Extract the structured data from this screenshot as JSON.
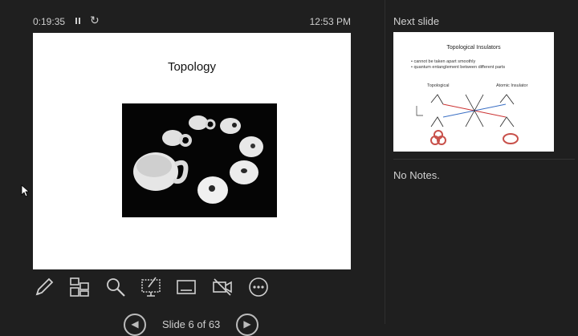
{
  "presenter": {
    "timer": "0:19:35",
    "clock": "12:53 PM",
    "pause_icon": "pause-icon",
    "restart_icon": "restart-icon"
  },
  "slide": {
    "title": "Topology",
    "image_desc_icon": "topology-photo"
  },
  "toolbar": {
    "tools": [
      "pen-icon",
      "slides-grid-icon",
      "zoom-icon",
      "pointer-screen-icon",
      "subtitles-icon",
      "camera-off-icon",
      "more-icon"
    ]
  },
  "navigation": {
    "counter": "Slide 6 of 63",
    "prev_icon": "chevron-left-icon",
    "next_icon": "chevron-right-icon"
  },
  "next_slide": {
    "label": "Next slide",
    "title": "Topological Insulators",
    "bullets": [
      "cannot be taken apart smoothly",
      "quantum entanglement between different parts"
    ],
    "left_label": "Topological",
    "right_label": "Atomic Insulator"
  },
  "notes": {
    "text": "No Notes."
  }
}
